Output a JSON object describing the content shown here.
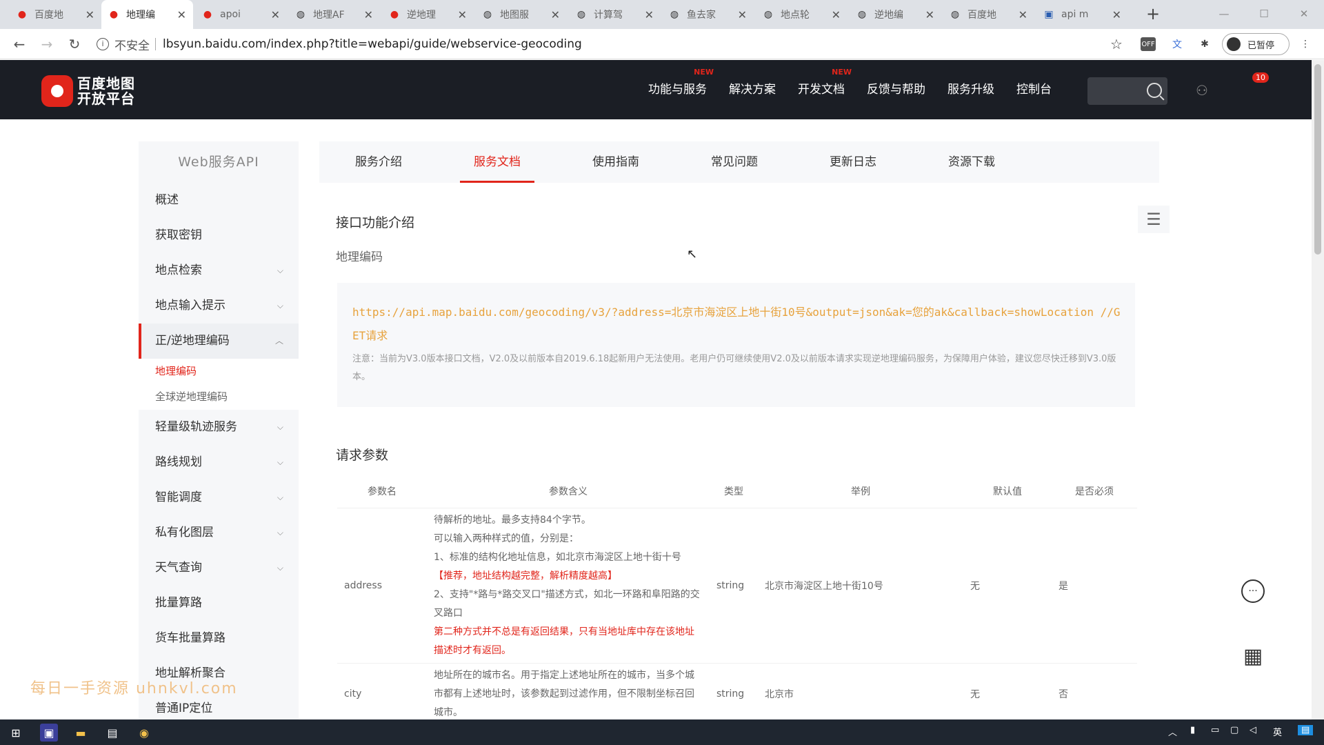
{
  "browser": {
    "tabs": [
      {
        "title": "百度地",
        "icon": "baidu-map-pin"
      },
      {
        "title": "地理编",
        "icon": "baidu-map-pin"
      },
      {
        "title": "apoi",
        "icon": "baidu-map-pin"
      },
      {
        "title": "地理AF",
        "icon": "globe"
      },
      {
        "title": "逆地理",
        "icon": "baidu-map-pin"
      },
      {
        "title": "地图服",
        "icon": "globe"
      },
      {
        "title": "计算驾",
        "icon": "globe"
      },
      {
        "title": "鱼去家",
        "icon": "globe"
      },
      {
        "title": "地点轮",
        "icon": "globe"
      },
      {
        "title": "逆地编",
        "icon": "globe"
      },
      {
        "title": "百度地",
        "icon": "globe"
      },
      {
        "title": "api m",
        "icon": "image"
      }
    ],
    "active_tab": 1,
    "security_label": "不安全",
    "url": "lbsyun.baidu.com/index.php?title=webapi/guide/webservice-geocoding",
    "profile_label": "已暂停"
  },
  "header": {
    "logo_line1": "百度地图",
    "logo_line2": "开放平台",
    "nav": [
      {
        "label": "功能与服务",
        "badge": "NEW"
      },
      {
        "label": "解决方案",
        "badge": ""
      },
      {
        "label": "开发文档",
        "badge": "NEW"
      },
      {
        "label": "反馈与帮助",
        "badge": ""
      },
      {
        "label": "服务升级",
        "badge": ""
      },
      {
        "label": "控制台",
        "badge": ""
      }
    ],
    "user_badge": "10"
  },
  "sidebar": {
    "title": "Web服务API",
    "items": [
      {
        "label": "概述",
        "chevron": ""
      },
      {
        "label": "获取密钥",
        "chevron": ""
      },
      {
        "label": "地点检索",
        "chevron": "⌵"
      },
      {
        "label": "地点输入提示",
        "chevron": "⌵"
      },
      {
        "label": "正/逆地理编码",
        "chevron": "︿"
      },
      {
        "label": "轻量级轨迹服务",
        "chevron": "⌵"
      },
      {
        "label": "路线规划",
        "chevron": "⌵"
      },
      {
        "label": "智能调度",
        "chevron": "⌵"
      },
      {
        "label": "私有化图层",
        "chevron": "⌵"
      },
      {
        "label": "天气查询",
        "chevron": "⌵"
      },
      {
        "label": "批量算路",
        "chevron": ""
      },
      {
        "label": "货车批量算路",
        "chevron": ""
      },
      {
        "label": "地址解析聚合",
        "chevron": ""
      },
      {
        "label": "普通IP定位",
        "chevron": ""
      }
    ],
    "subitems": [
      "地理编码",
      "全球逆地理编码"
    ]
  },
  "watermark": "每日一手资源  uhnkvl.com",
  "content_tabs": [
    "服务介绍",
    "服务文档",
    "使用指南",
    "常见问题",
    "更新日志",
    "资源下载"
  ],
  "content": {
    "section1_title": "接口功能介绍",
    "section1_sub": "地理编码",
    "code_url": "https://api.map.baidu.com/geocoding/v3/?address=北京市海淀区上地十街10号&output=json&ak=您的ak&callback=showLocation //GET请求",
    "code_note": "注意：当前为V3.0版本接口文档，V2.0及以前版本自2019.6.18起新用户无法使用。老用户仍可继续使用V2.0及以前版本请求实现逆地理编码服务，为保障用户体验，建议您尽快迁移到V3.0版本。",
    "section2_title": "请求参数",
    "table_headers": [
      "参数名",
      "参数含义",
      "类型",
      "举例",
      "默认值",
      "是否必须"
    ],
    "row1": {
      "name": "address",
      "desc_line1": "待解析的地址。最多支持84个字节。",
      "desc_line2": "可以输入两种样式的值，分别是：",
      "desc_line3": "1、标准的结构化地址信息，如北京市海淀区上地十街十号",
      "desc_red1": "【推荐，地址结构越完整，解析精度越高】",
      "desc_line4": "2、支持\"*路与*路交叉口\"描述方式，如北一环路和阜阳路的交叉路口",
      "desc_red2": "第二种方式并不总是有返回结果，只有当地址库中存在该地址描述时才有返回。",
      "type": "string",
      "example": "北京市海淀区上地十街10号",
      "default": "无",
      "required": "是"
    },
    "row2": {
      "name": "city",
      "desc": "地址所在的城市名。用于指定上述地址所在的城市，当多个城市都有上述地址时，该参数起到过滤作用，但不限制坐标召回城市。",
      "type": "string",
      "example": "北京市",
      "default": "无",
      "required": "否"
    }
  },
  "colors": {
    "accent": "#e1251b",
    "header_bg": "#1b1e25",
    "code_text": "#e7a23c"
  }
}
